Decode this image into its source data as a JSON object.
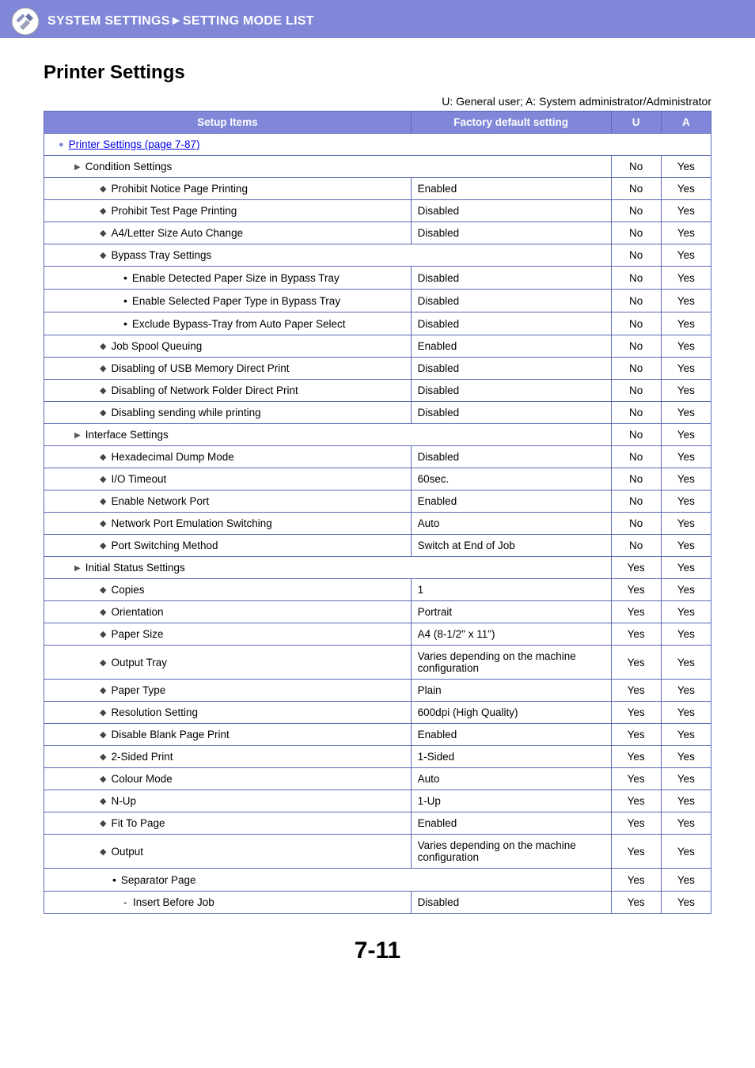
{
  "header": {
    "breadcrumb": "SYSTEM SETTINGS►SETTING MODE LIST"
  },
  "page": {
    "title": "Printer Settings",
    "legend": "U: General user; A: System administrator/Administrator",
    "page_number": "7-11"
  },
  "table": {
    "headers": {
      "setup": "Setup Items",
      "factory": "Factory default setting",
      "u": "U",
      "a": "A"
    },
    "section_link": "Printer Settings (page 7-87)",
    "groups": [
      {
        "label": "Condition Settings",
        "u": "No",
        "a": "Yes",
        "items": [
          {
            "type": "diamond",
            "label": "Prohibit Notice Page Printing",
            "factory": "Enabled",
            "u": "No",
            "a": "Yes"
          },
          {
            "type": "diamond",
            "label": "Prohibit Test Page Printing",
            "factory": "Disabled",
            "u": "No",
            "a": "Yes"
          },
          {
            "type": "diamond",
            "label": "A4/Letter Size Auto Change",
            "factory": "Disabled",
            "u": "No",
            "a": "Yes"
          },
          {
            "type": "diamond",
            "label": "Bypass Tray Settings",
            "span": true,
            "u": "No",
            "a": "Yes"
          },
          {
            "type": "dot",
            "indent": "ind3",
            "label": "Enable Detected Paper Size in Bypass Tray",
            "factory": "Disabled",
            "u": "No",
            "a": "Yes"
          },
          {
            "type": "dot",
            "indent": "ind3",
            "label": "Enable Selected Paper Type in Bypass Tray",
            "factory": "Disabled",
            "u": "No",
            "a": "Yes"
          },
          {
            "type": "dot",
            "indent": "ind3",
            "label": "Exclude Bypass-Tray from Auto Paper Select",
            "factory": "Disabled",
            "u": "No",
            "a": "Yes"
          },
          {
            "type": "diamond",
            "label": "Job Spool Queuing",
            "factory": "Enabled",
            "u": "No",
            "a": "Yes"
          },
          {
            "type": "diamond",
            "label": "Disabling of USB Memory Direct Print",
            "factory": "Disabled",
            "u": "No",
            "a": "Yes"
          },
          {
            "type": "diamond",
            "label": "Disabling of Network Folder Direct Print",
            "factory": "Disabled",
            "u": "No",
            "a": "Yes"
          },
          {
            "type": "diamond",
            "label": "Disabling sending while printing",
            "factory": "Disabled",
            "u": "No",
            "a": "Yes"
          }
        ]
      },
      {
        "label": "Interface Settings",
        "u": "No",
        "a": "Yes",
        "items": [
          {
            "type": "diamond",
            "label": "Hexadecimal Dump Mode",
            "factory": "Disabled",
            "u": "No",
            "a": "Yes"
          },
          {
            "type": "diamond",
            "label": "I/O Timeout",
            "factory": "60sec.",
            "u": "No",
            "a": "Yes"
          },
          {
            "type": "diamond",
            "label": "Enable Network Port",
            "factory": "Enabled",
            "u": "No",
            "a": "Yes"
          },
          {
            "type": "diamond",
            "label": "Network Port Emulation Switching",
            "factory": "Auto",
            "u": "No",
            "a": "Yes"
          },
          {
            "type": "diamond",
            "label": "Port Switching Method",
            "factory": "Switch at End of Job",
            "u": "No",
            "a": "Yes"
          }
        ]
      },
      {
        "label": "Initial Status Settings",
        "u": "Yes",
        "a": "Yes",
        "items": [
          {
            "type": "diamond",
            "label": "Copies",
            "factory": "1",
            "u": "Yes",
            "a": "Yes"
          },
          {
            "type": "diamond",
            "label": "Orientation",
            "factory": "Portrait",
            "u": "Yes",
            "a": "Yes"
          },
          {
            "type": "diamond",
            "label": "Paper Size",
            "factory": "A4 (8-1/2\" x 11\")",
            "u": "Yes",
            "a": "Yes"
          },
          {
            "type": "diamond",
            "label": "Output Tray",
            "factory": "Varies depending on the machine configuration",
            "u": "Yes",
            "a": "Yes"
          },
          {
            "type": "diamond",
            "label": "Paper Type",
            "factory": "Plain",
            "u": "Yes",
            "a": "Yes"
          },
          {
            "type": "diamond",
            "label": "Resolution Setting",
            "factory": "600dpi (High Quality)",
            "u": "Yes",
            "a": "Yes"
          },
          {
            "type": "diamond",
            "label": "Disable Blank Page Print",
            "factory": "Enabled",
            "u": "Yes",
            "a": "Yes"
          },
          {
            "type": "diamond",
            "label": "2-Sided Print",
            "factory": "1-Sided",
            "u": "Yes",
            "a": "Yes"
          },
          {
            "type": "diamond",
            "label": "Colour Mode",
            "factory": "Auto",
            "u": "Yes",
            "a": "Yes"
          },
          {
            "type": "diamond",
            "label": "N-Up",
            "factory": "1-Up",
            "u": "Yes",
            "a": "Yes"
          },
          {
            "type": "diamond",
            "label": "Fit To Page",
            "factory": "Enabled",
            "u": "Yes",
            "a": "Yes"
          },
          {
            "type": "diamond",
            "label": "Output",
            "factory": "Varies depending on the machine configuration",
            "u": "Yes",
            "a": "Yes"
          },
          {
            "type": "dot",
            "indent": "ind2b",
            "label": "Separator Page",
            "span": true,
            "u": "Yes",
            "a": "Yes"
          },
          {
            "type": "dash",
            "indent": "ind3",
            "label": "Insert Before Job",
            "factory": "Disabled",
            "u": "Yes",
            "a": "Yes"
          }
        ]
      }
    ]
  }
}
